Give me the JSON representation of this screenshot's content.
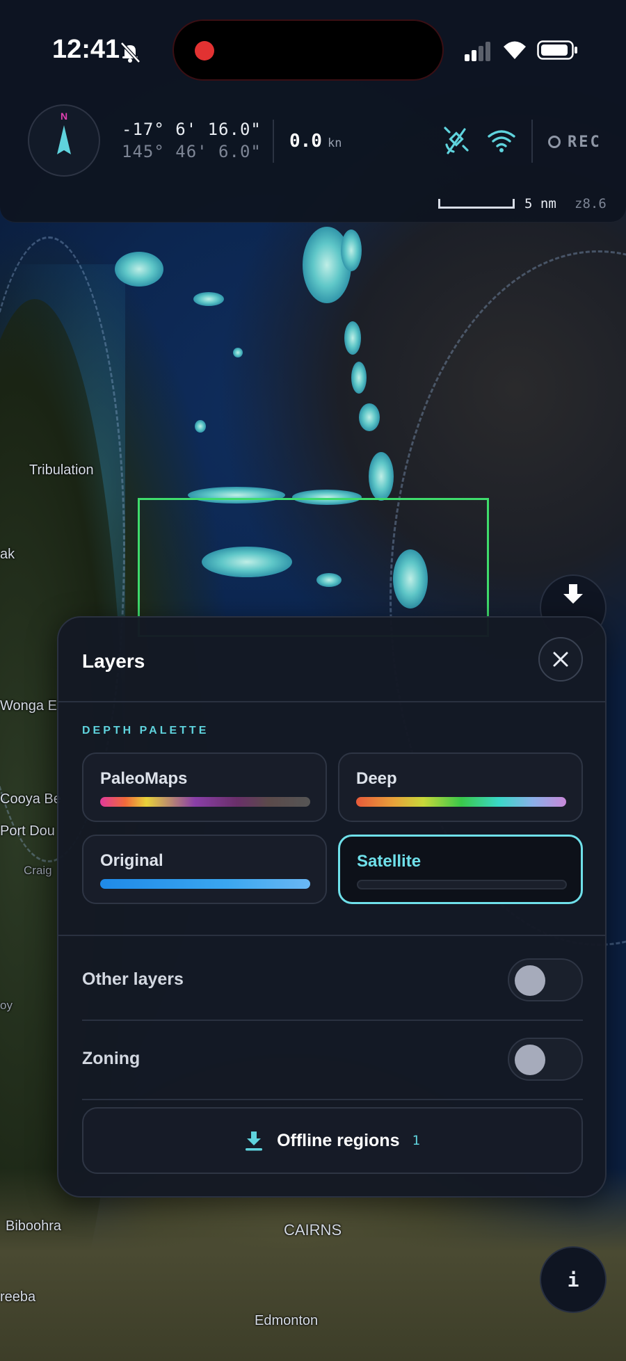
{
  "status_bar": {
    "time": "12:41",
    "icons": [
      "bell-slash-icon",
      "record-dot-icon",
      "cellular-signal-icon",
      "wifi-icon",
      "battery-icon"
    ]
  },
  "nav": {
    "compass_label": "N",
    "latitude": "-17° 6' 16.0\"",
    "longitude": "145° 46' 6.0\"",
    "speed_value": "0.0",
    "speed_unit": "kn",
    "rec_label": "REC",
    "scale_label": "5 nm",
    "zoom_label": "z8.6",
    "icons": [
      "satellite-off-icon",
      "wifi-icon",
      "record-ring-icon"
    ]
  },
  "map": {
    "labels": [
      "Tribulation",
      "ak",
      "Wonga E",
      "Cooya Be",
      "Port Dou",
      "Craig",
      "oy",
      "Biboohra",
      "CAIRNS",
      "reeba",
      "Edmonton"
    ],
    "region_box_color": "#3fdc6c"
  },
  "fabs": {
    "download_icon": "download-arrow-icon",
    "info_label": "i"
  },
  "layers": {
    "title": "Layers",
    "section_label": "DEPTH PALETTE",
    "palettes": [
      {
        "name": "PaleoMaps",
        "selected": false
      },
      {
        "name": "Deep",
        "selected": false
      },
      {
        "name": "Original",
        "selected": false
      },
      {
        "name": "Satellite",
        "selected": true
      }
    ],
    "toggles": [
      {
        "label": "Other layers",
        "on": false
      },
      {
        "label": "Zoning",
        "on": false
      }
    ],
    "offline_label": "Offline regions",
    "offline_count": "1",
    "accent_color": "#6fe0ea"
  }
}
